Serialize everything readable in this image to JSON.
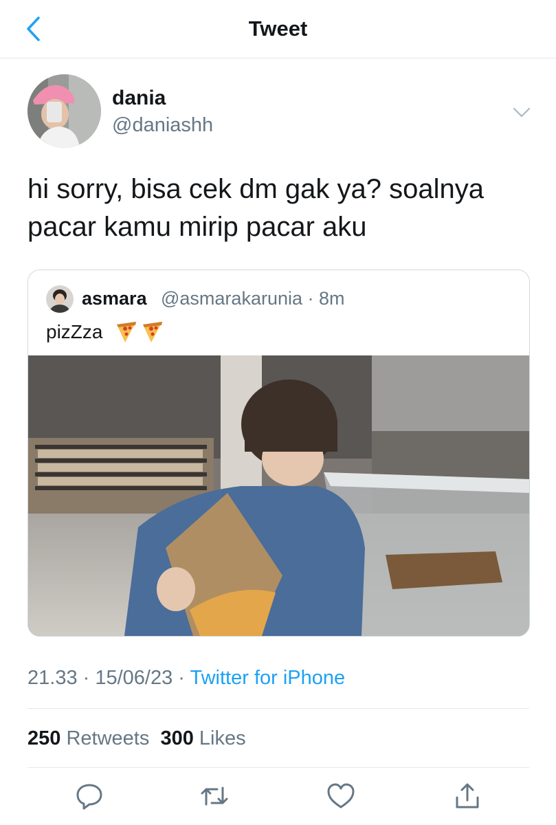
{
  "header": {
    "title": "Tweet",
    "back_icon": "chevron-left-icon"
  },
  "tweet": {
    "author_name": "dania",
    "author_handle": "@daniashh",
    "text": "hi sorry, bisa cek dm gak ya? soalnya\npacar kamu mirip pacar aku",
    "timestamp": "21.33 · 15/06/23 · ",
    "source": "Twitter for iPhone",
    "retweets_count": "250",
    "retweets_label": "Retweets",
    "likes_count": "300",
    "likes_label": "Likes"
  },
  "quote": {
    "author_name": "asmara",
    "author_handle": "@asmarakarunia · 8m",
    "text": "pizZza",
    "emoji": "pizza-emoji"
  },
  "actions": [
    "reply-icon",
    "retweet-icon",
    "like-icon",
    "share-icon"
  ],
  "colors": {
    "accent": "#1da1f2",
    "secondary_text": "#657786",
    "divider": "#e1e8ed"
  }
}
